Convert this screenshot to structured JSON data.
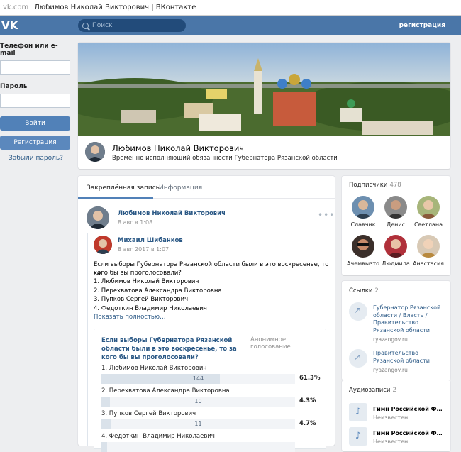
{
  "browser": {
    "url": "vk.com",
    "title": "Любимов Николай Викторович | ВКонтакте"
  },
  "header": {
    "logo": "VK",
    "search_placeholder": "Поиск",
    "register": "регистрация"
  },
  "login": {
    "phone_label": "Телефон или e-mail",
    "password_label": "Пароль",
    "login_button": "Войти",
    "register_button": "Регистрация",
    "forgot": "Забыли пароль?"
  },
  "profile": {
    "name": "Любимов Николай Викторович",
    "status": "Временно исполняющий обязанности Губернатора Рязанской области"
  },
  "wall": {
    "tabs": [
      "Закреплённая запись",
      "Информация"
    ],
    "post": {
      "author": "Любимов Николай Викторович",
      "date": "8 авг в 1:08",
      "repost_author": "Михаил Шибанков",
      "repost_date": "8 авг 2017 в 1:07",
      "text_lines": [
        "Если выборы Губернатора Рязанской области были в это воскресенье, то за",
        "кого бы вы проголосовали?",
        "1. Любимов Николай Викторович",
        "2. Перехватова Александра Викторовна",
        "3. Пупков Сергей Викторович",
        "4. Федоткин Владимир Николаевич"
      ],
      "show_more": "Показать полностью…"
    },
    "poll": {
      "question": "Если выборы Губернатора Рязанской области были в это воскресенье, то за кого бы вы проголосовали?",
      "type": "Анонимное голосование",
      "options": [
        {
          "label": "1. Любимов Николай Викторович",
          "count": "144",
          "percent": "61.3%",
          "share": 0.613
        },
        {
          "label": "2. Перехватова Александра Викторовна",
          "count": "10",
          "percent": "4.3%",
          "share": 0.043
        },
        {
          "label": "3. Пупков Сергей Викторович",
          "count": "11",
          "percent": "4.7%",
          "share": 0.047
        },
        {
          "label": "4. Федоткин Владимир Николаевич",
          "count": "",
          "percent": "",
          "share": 0.03
        }
      ]
    }
  },
  "subscribers": {
    "title": "Подписчики",
    "count": "478",
    "people": [
      "Славчик",
      "Денис",
      "Светлана",
      "Ачемвызто",
      "Людмила",
      "Анастасия"
    ]
  },
  "links": {
    "title": "Ссылки",
    "count": "2",
    "items": [
      {
        "title": "Губернатор Рязанской области / Власть / Правительство Рязанской области",
        "domain": "ryazangov.ru"
      },
      {
        "title": "Правительство Рязанской области",
        "domain": "ryazangov.ru"
      }
    ]
  },
  "audio": {
    "title": "Аудиозаписи",
    "count": "2",
    "items": [
      {
        "title": "Гимн Российской Федерации",
        "artist": "Неизвестен"
      },
      {
        "title": "Гимн Российской Федерации",
        "artist": "Неизвестен"
      }
    ]
  }
}
